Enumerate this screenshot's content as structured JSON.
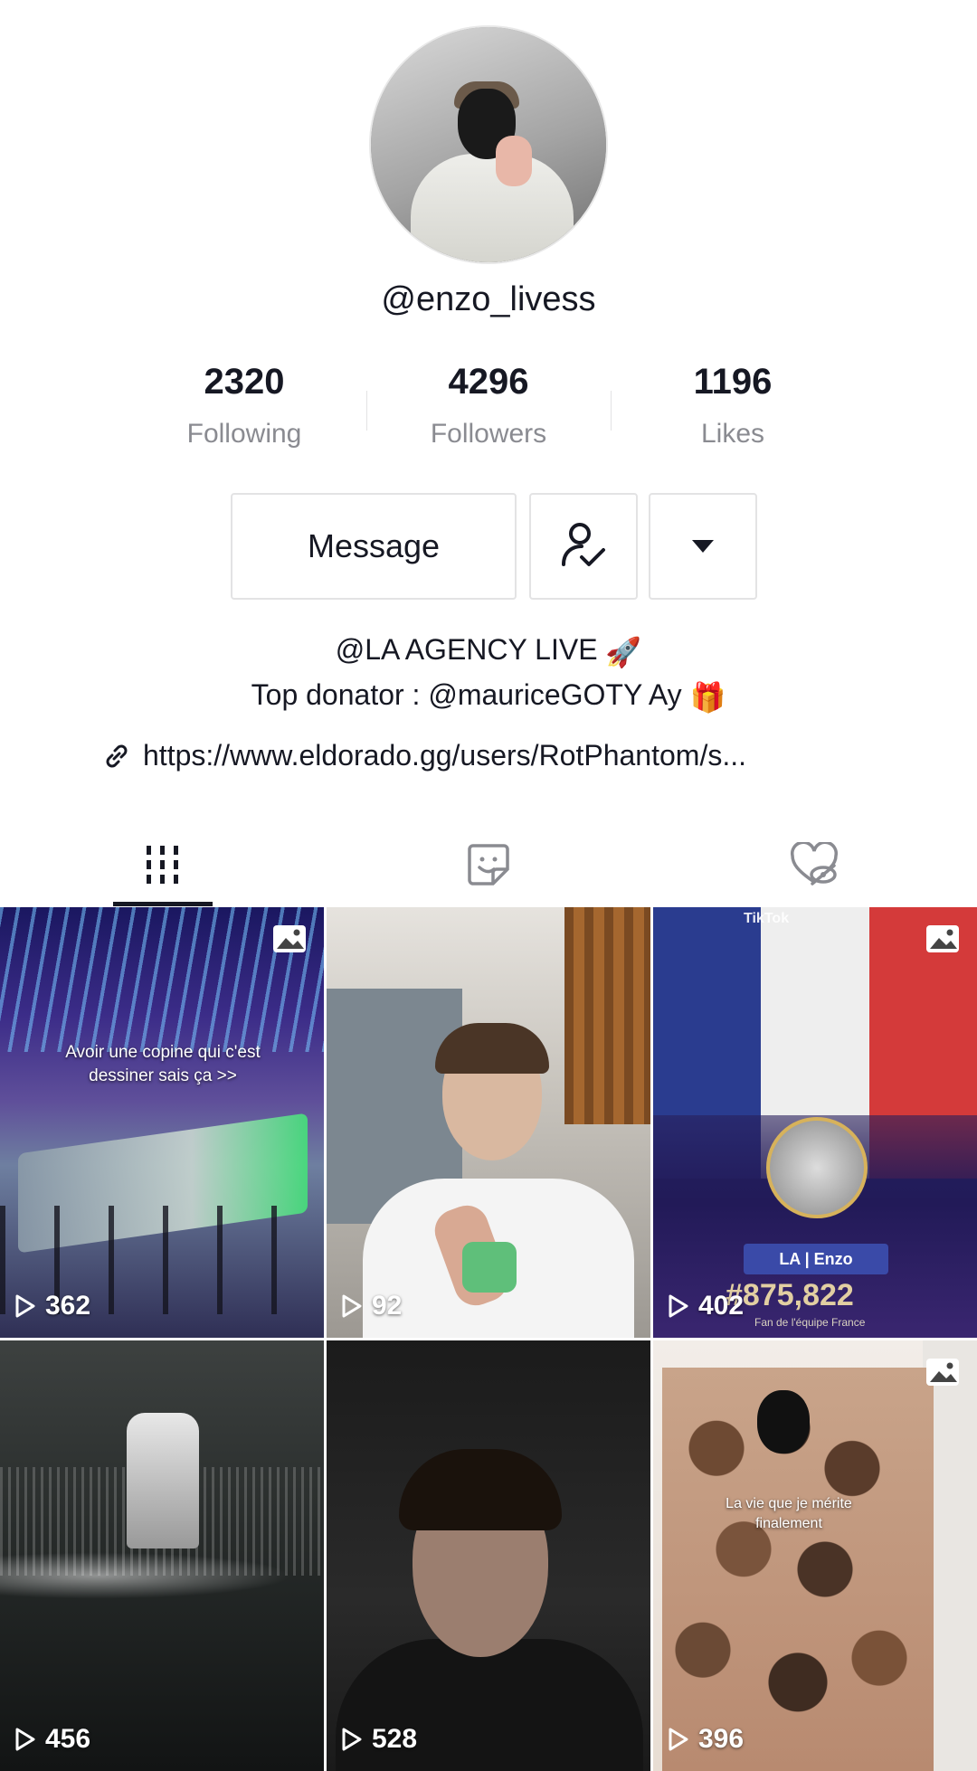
{
  "profile": {
    "username": "@enzo_livess",
    "stats": [
      {
        "value": "2320",
        "label": "Following"
      },
      {
        "value": "4296",
        "label": "Followers"
      },
      {
        "value": "1196",
        "label": "Likes"
      }
    ],
    "message_label": "Message",
    "bio_line1": "@LA AGENCY LIVE",
    "bio_line1_emoji": "🚀",
    "bio_line2": "Top donator : @mauriceGOTY Ay",
    "bio_line2_emoji": "🎁",
    "link": "https://www.eldorado.gg/users/RotPhantom/s..."
  },
  "tabs": [
    {
      "icon": "grid-videos-icon",
      "active": true
    },
    {
      "icon": "sticker-icon",
      "active": false
    },
    {
      "icon": "liked-hidden-icon",
      "active": false
    }
  ],
  "videos": [
    {
      "views": "362",
      "photo": true,
      "caption": "Avoir une copine qui c'est dessiner sais ça >>"
    },
    {
      "views": "92",
      "photo": false
    },
    {
      "views": "402",
      "photo": true,
      "overlay_name": "LA | Enzo",
      "overlay_rank": "#875,822",
      "overlay_fan": "Fan de l'équipe France",
      "overlay_logo": "TikTok"
    },
    {
      "views": "456",
      "photo": false
    },
    {
      "views": "528",
      "photo": false
    },
    {
      "views": "396",
      "photo": true,
      "caption": "La vie que je mérite finalement"
    }
  ],
  "colors": {
    "text": "#161823",
    "muted": "#8a8b91",
    "border": "#e3e3e4"
  }
}
